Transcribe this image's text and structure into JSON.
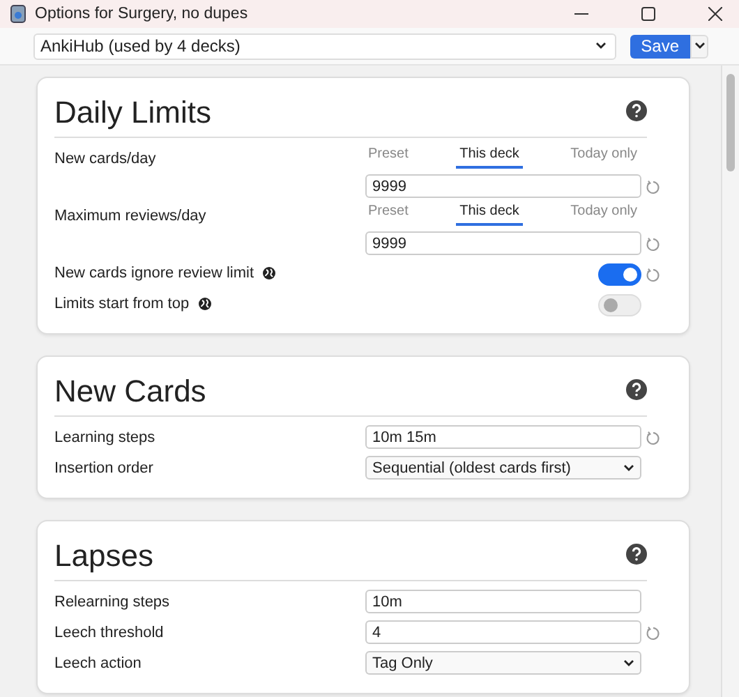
{
  "window": {
    "title": "Options for Surgery, no dupes"
  },
  "toolbar": {
    "preset": "AnkiHub (used by 4 decks)",
    "save_label": "Save"
  },
  "sections": [
    {
      "title": "Daily Limits",
      "rows": [
        {
          "kind": "number_tabs",
          "label": "New cards/day",
          "global": false,
          "reset": true,
          "value": "9999",
          "tabs": [
            {
              "label": "Preset",
              "selected": false
            },
            {
              "label": "This deck",
              "selected": true
            },
            {
              "label": "Today only",
              "selected": false
            }
          ]
        },
        {
          "kind": "number_tabs",
          "label": "Maximum reviews/day",
          "global": false,
          "reset": true,
          "value": "9999",
          "tabs": [
            {
              "label": "Preset",
              "selected": false
            },
            {
              "label": "This deck",
              "selected": true
            },
            {
              "label": "Today only",
              "selected": false
            }
          ]
        },
        {
          "kind": "toggle",
          "label": "New cards ignore review limit",
          "global": true,
          "reset": true,
          "on": true
        },
        {
          "kind": "toggle",
          "label": "Limits start from top",
          "global": true,
          "reset": false,
          "on": false
        }
      ]
    },
    {
      "title": "New Cards",
      "rows": [
        {
          "kind": "text",
          "label": "Learning steps",
          "global": false,
          "reset": true,
          "value": "10m 15m"
        },
        {
          "kind": "select",
          "label": "Insertion order",
          "global": false,
          "reset": false,
          "value": "Sequential (oldest cards first)"
        }
      ]
    },
    {
      "title": "Lapses",
      "rows": [
        {
          "kind": "text",
          "label": "Relearning steps",
          "global": false,
          "reset": false,
          "value": "10m"
        },
        {
          "kind": "text",
          "label": "Leech threshold",
          "global": false,
          "reset": true,
          "value": "4"
        },
        {
          "kind": "select",
          "label": "Leech action",
          "global": false,
          "reset": false,
          "value": "Tag Only"
        }
      ]
    }
  ]
}
